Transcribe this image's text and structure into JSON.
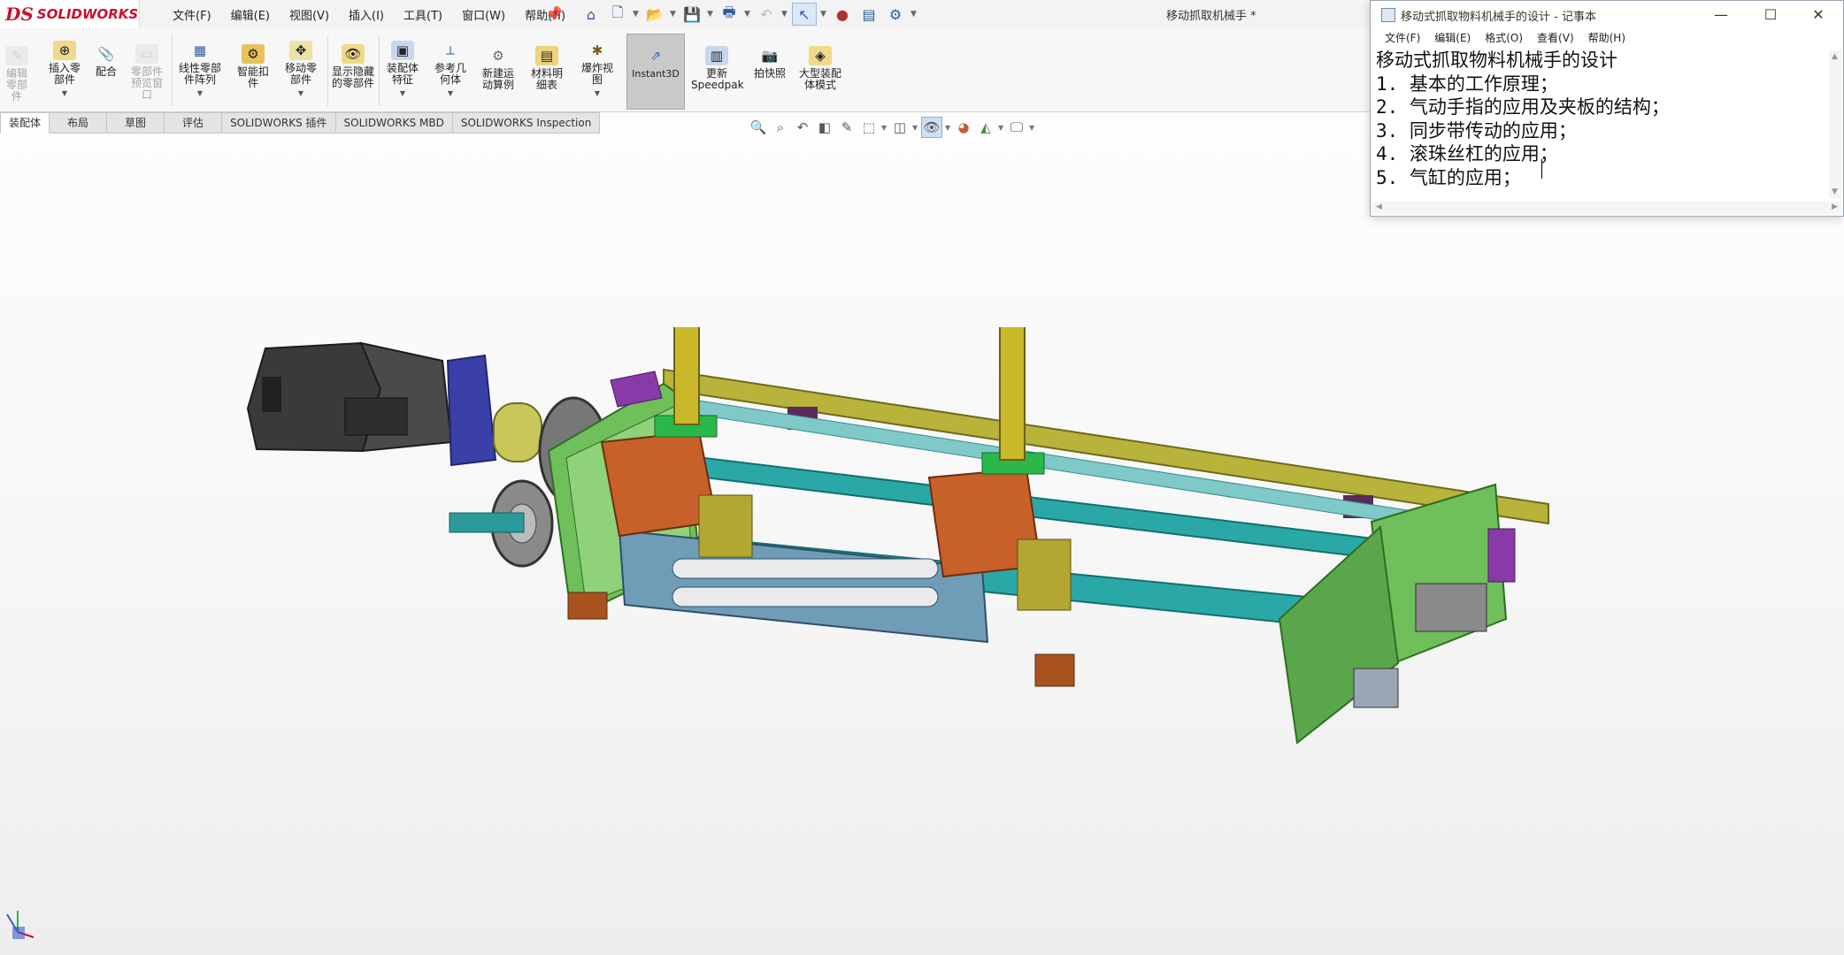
{
  "app": {
    "logo_mark": "DS",
    "logo_text": "SOLIDWORKS",
    "document_title": "移动抓取机械手 *"
  },
  "menu": [
    "文件(F)",
    "编辑(E)",
    "视图(V)",
    "插入(I)",
    "工具(T)",
    "窗口(W)",
    "帮助(H)"
  ],
  "ribbon": {
    "commands": [
      {
        "label": "编辑零部件",
        "enabled": false
      },
      {
        "label": "插入零部件",
        "enabled": true
      },
      {
        "label": "配合",
        "enabled": true
      },
      {
        "label": "零部件预览窗口",
        "enabled": false
      },
      {
        "label": "线性零部件阵列",
        "enabled": true
      },
      {
        "label": "智能扣件",
        "enabled": true
      },
      {
        "label": "移动零部件",
        "enabled": true
      },
      {
        "label": "显示隐藏的零部件",
        "enabled": true
      },
      {
        "label": "装配体特征",
        "enabled": true
      },
      {
        "label": "参考几何体",
        "enabled": true
      },
      {
        "label": "新建运动算例",
        "enabled": true
      },
      {
        "label": "材料明细表",
        "enabled": true
      },
      {
        "label": "爆炸视图",
        "enabled": true
      },
      {
        "label": "Instant3D",
        "enabled": true
      },
      {
        "label": "更新Speedpak",
        "enabled": true
      },
      {
        "label": "拍快照",
        "enabled": true
      },
      {
        "label": "大型装配体模式",
        "enabled": true
      }
    ]
  },
  "tabs": [
    "装配体",
    "布局",
    "草图",
    "评估",
    "SOLIDWORKS 插件",
    "SOLIDWORKS MBD",
    "SOLIDWORKS Inspection"
  ],
  "notepad": {
    "title": "移动式抓取物料机械手的设计 - 记事本",
    "menu": [
      "文件(F)",
      "编辑(E)",
      "格式(O)",
      "查看(V)",
      "帮助(H)"
    ],
    "lines": [
      "移动式抓取物料机械手的设计",
      "1. 基本的工作原理；",
      "2. 气动手指的应用及夹板的结构；",
      "3. 同步带传动的应用；",
      "4. 滚珠丝杠的应用；",
      "5. 气缸的应用；"
    ]
  },
  "colors": {
    "accent": "#c8102e",
    "frame_green": "#6fbf5a",
    "rail_olive": "#b8b33a",
    "shaft_teal": "#2aa8a8",
    "plate_steel": "#6f9db8",
    "block_orange": "#c8602a",
    "motor_dark": "#3a3a3a"
  }
}
